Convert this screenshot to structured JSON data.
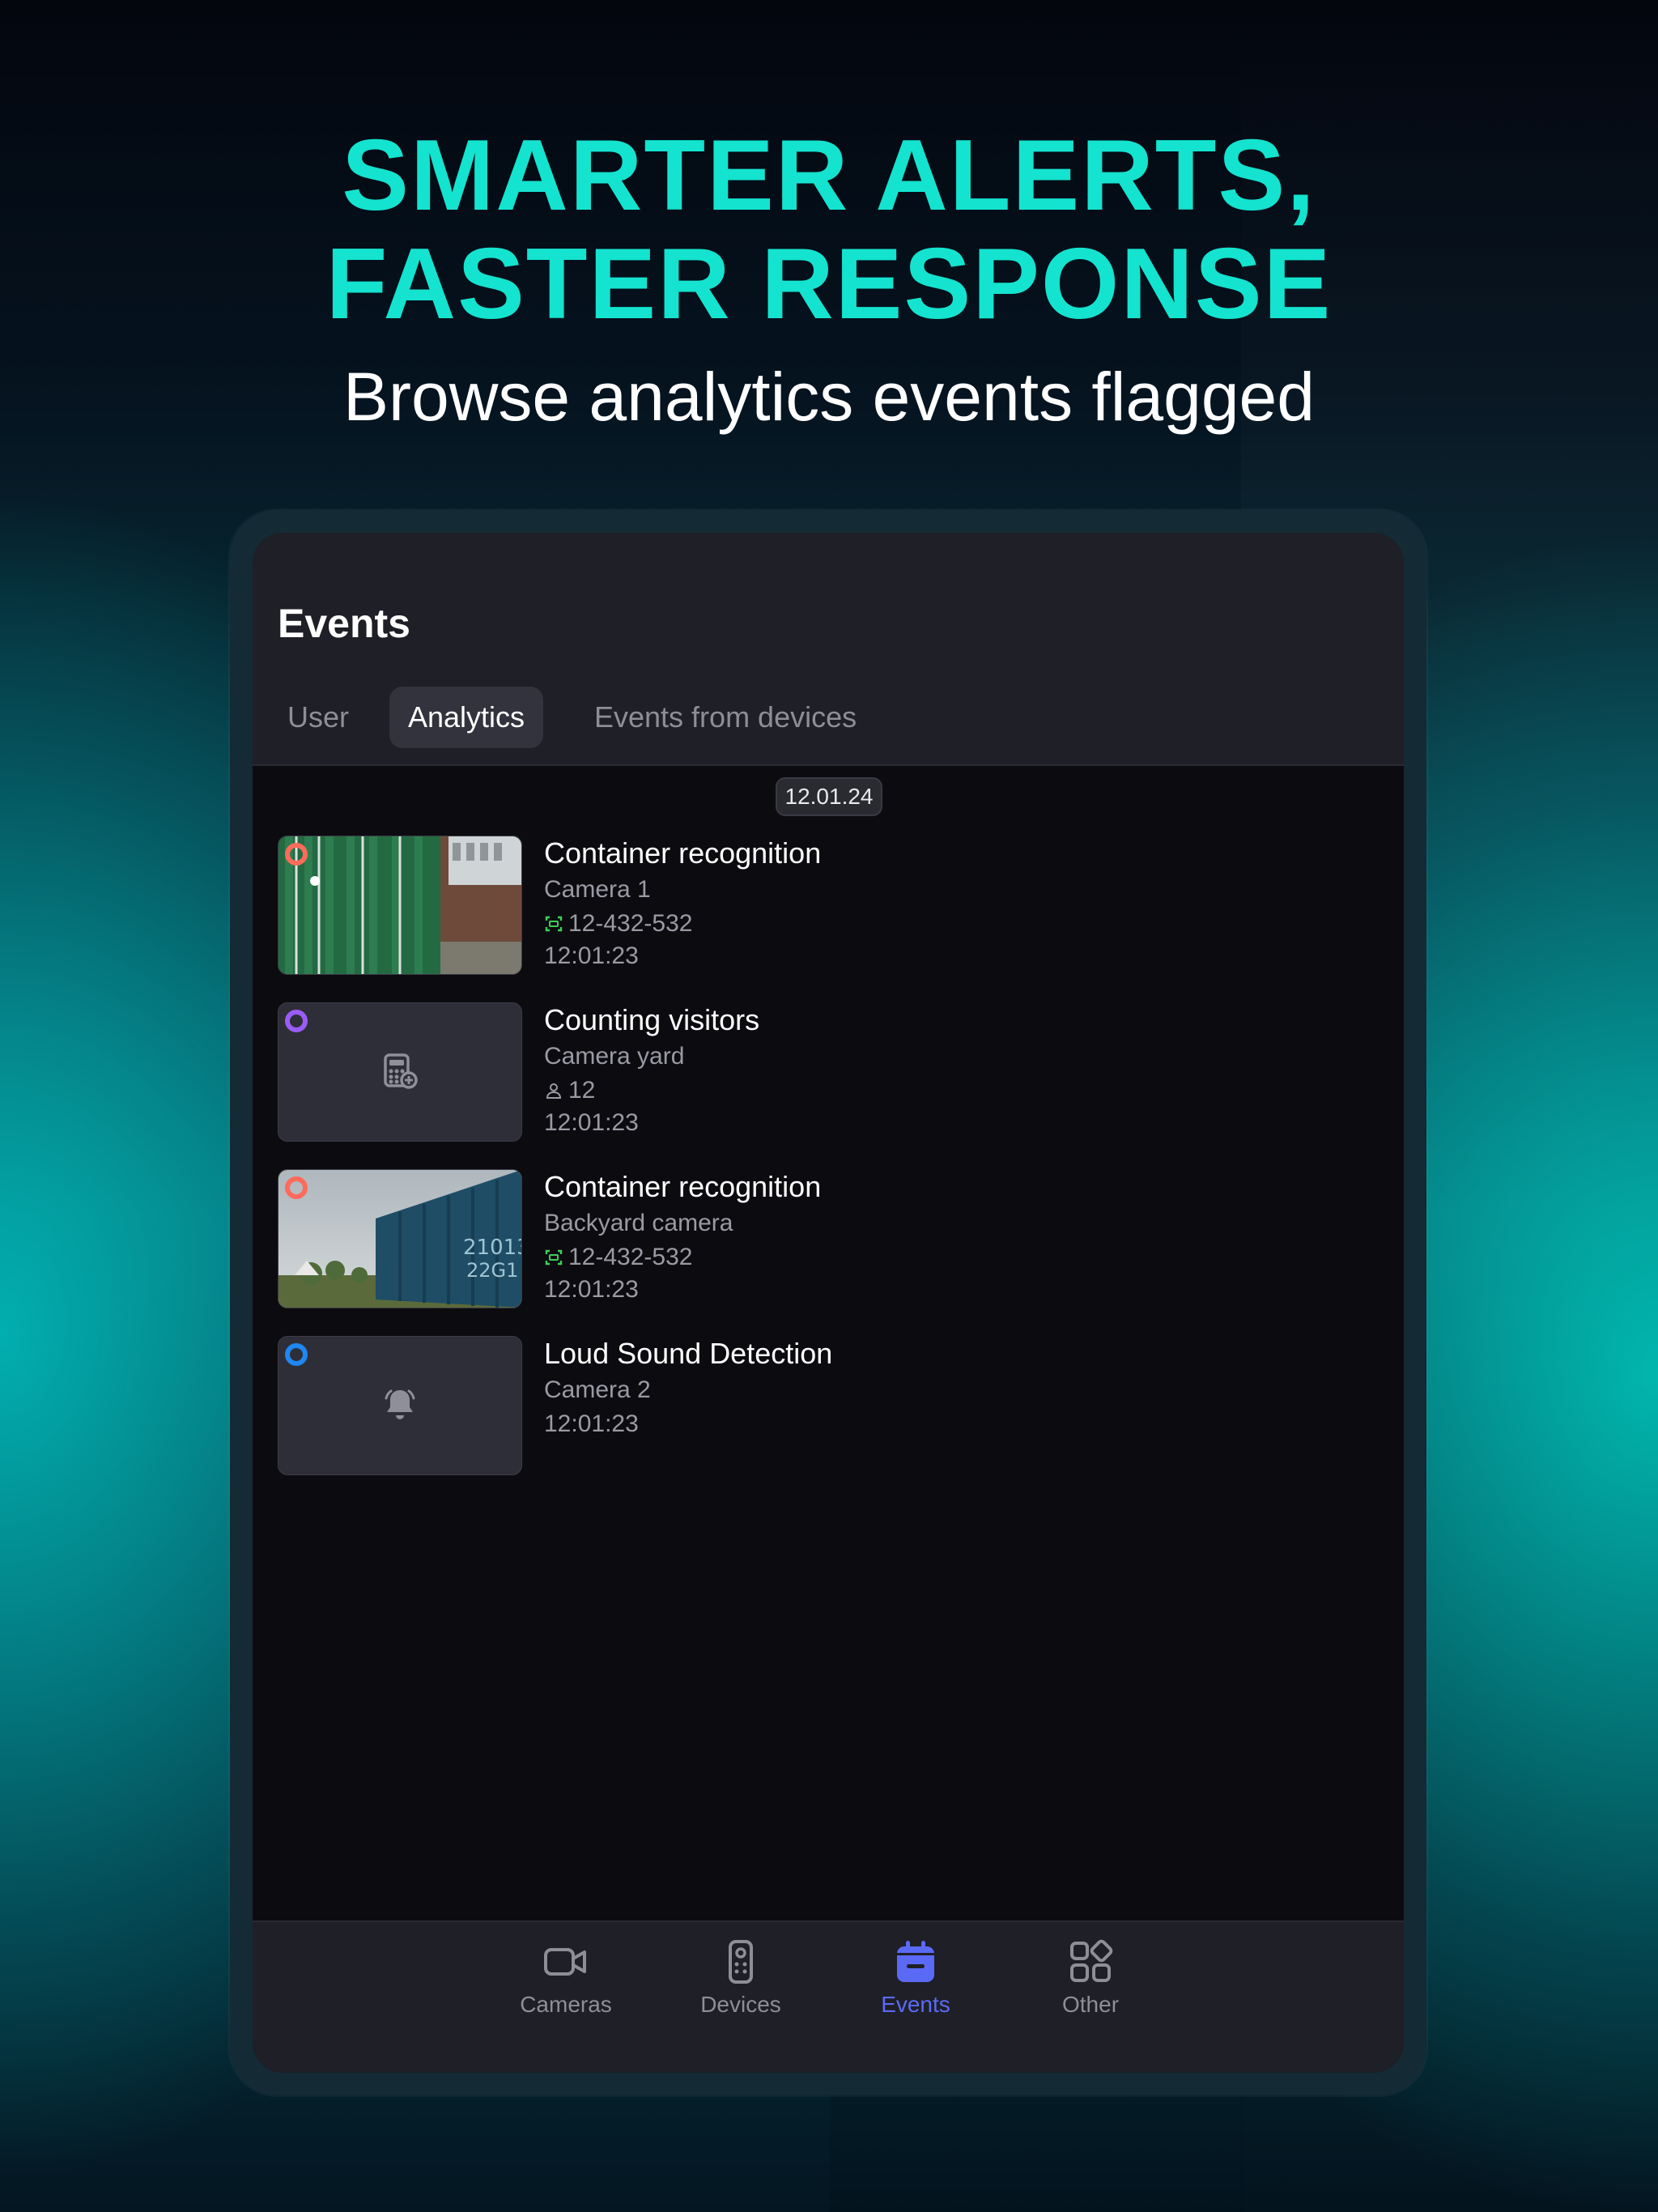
{
  "headline": {
    "line1": "SMARTER ALERTS,",
    "line2": "FASTER RESPONSE"
  },
  "subtitle": "Browse analytics events flagged",
  "app": {
    "title": "Events",
    "tabs": [
      {
        "label": "User",
        "active": false
      },
      {
        "label": "Analytics",
        "active": true
      },
      {
        "label": "Events from devices",
        "active": false
      }
    ],
    "date": "12.01.24",
    "events": [
      {
        "title": "Container recognition",
        "camera": "Camera 1",
        "detail": "12-432-532",
        "detail_icon": "plate-scan-icon",
        "time": "12:01:23",
        "dot_color": "#ff6b5b",
        "thumb": "green-containers-photo"
      },
      {
        "title": "Counting visitors",
        "camera": "Camera yard",
        "detail": "12",
        "detail_icon": "person-icon",
        "time": "12:01:23",
        "dot_color": "#9b5cf6",
        "thumb": "calculator-icon"
      },
      {
        "title": "Container recognition",
        "camera": "Backyard camera",
        "detail": "12-432-532",
        "detail_icon": "plate-scan-icon",
        "time": "12:01:23",
        "dot_color": "#ff6b5b",
        "thumb": "blue-container-photo"
      },
      {
        "title": "Loud Sound Detection",
        "camera": "Camera 2",
        "time": "12:01:23",
        "dot_color": "#1e88f0",
        "thumb": "bell-icon"
      }
    ],
    "nav": [
      {
        "label": "Cameras",
        "icon": "camera-icon",
        "active": false
      },
      {
        "label": "Devices",
        "icon": "remote-icon",
        "active": false
      },
      {
        "label": "Events",
        "icon": "calendar-icon",
        "active": true
      },
      {
        "label": "Other",
        "icon": "grid-icon",
        "active": false
      }
    ]
  },
  "colors": {
    "accent": "#14e3cf",
    "nav_active": "#5b6af5",
    "plate_icon": "#3ecf5a"
  }
}
